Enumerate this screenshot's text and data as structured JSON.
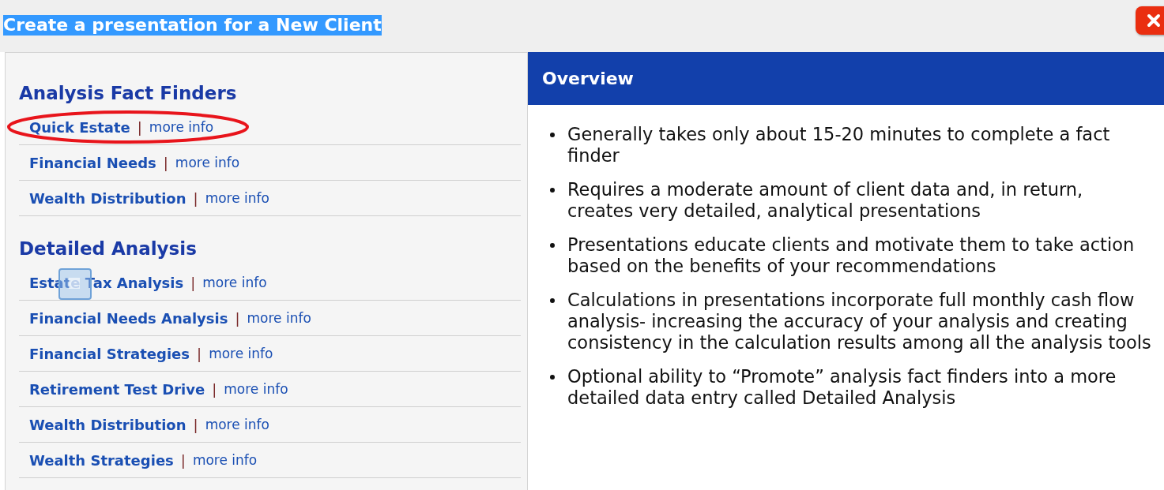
{
  "dialog": {
    "title": "Create a presentation for a New Client",
    "title_selected": true
  },
  "sections": [
    {
      "heading": "Analysis Fact Finders",
      "items": [
        {
          "label": "Quick Estate",
          "sep": "|",
          "more": "more info",
          "circled": true,
          "drag_icon": false
        },
        {
          "label": "Financial Needs",
          "sep": "|",
          "more": "more info",
          "circled": false,
          "drag_icon": false
        },
        {
          "label": "Wealth Distribution",
          "sep": "|",
          "more": "more info",
          "circled": false,
          "drag_icon": false
        }
      ]
    },
    {
      "heading": "Detailed Analysis",
      "items": [
        {
          "label": "Estate Tax Analysis",
          "sep": "|",
          "more": "more info",
          "circled": false,
          "drag_icon": true
        },
        {
          "label": "Financial Needs Analysis",
          "sep": "|",
          "more": "more info",
          "circled": false,
          "drag_icon": false
        },
        {
          "label": "Financial Strategies",
          "sep": "|",
          "more": "more info",
          "circled": false,
          "drag_icon": false
        },
        {
          "label": "Retirement Test Drive",
          "sep": "|",
          "more": "more info",
          "circled": false,
          "drag_icon": false
        },
        {
          "label": "Wealth Distribution",
          "sep": "|",
          "more": "more info",
          "circled": false,
          "drag_icon": false
        },
        {
          "label": "Wealth Strategies",
          "sep": "|",
          "more": "more info",
          "circled": false,
          "drag_icon": false
        }
      ]
    }
  ],
  "overview": {
    "heading": "Overview",
    "bullets": [
      "Generally takes only about 15-20 minutes to complete a fact finder",
      "Requires a moderate amount of client data and, in return, creates very detailed, analytical presentations",
      "Presentations educate clients and motivate them to take action based on the benefits of your recommendations",
      "Calculations in presentations incorporate full monthly cash flow analysis- increasing the accuracy of your analysis and creating consistency in the calculation results among all the analysis tools",
      "Optional ability to “Promote” analysis fact finders into a more detailed data entry called Detailed Analysis"
    ]
  }
}
